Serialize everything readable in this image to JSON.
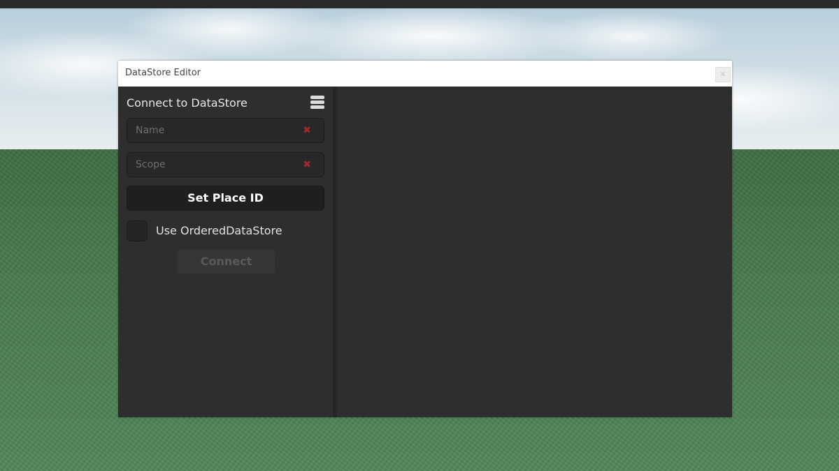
{
  "window": {
    "title": "DataStore Editor",
    "close_glyph": "✕"
  },
  "connect_panel": {
    "heading": "Connect to DataStore",
    "menu_icon": "hamburger-menu-icon",
    "name_field": {
      "placeholder": "Name",
      "value": "",
      "clear_glyph": "✖"
    },
    "scope_field": {
      "placeholder": "Scope",
      "value": "",
      "clear_glyph": "✖"
    },
    "set_place_id_label": "Set Place ID",
    "ordered_checkbox": {
      "label": "Use OrderedDataStore",
      "checked": false
    },
    "connect_label": "Connect",
    "connect_enabled": false
  },
  "colors": {
    "panel_bg": "#2e2e2e",
    "titlebar_bg": "#ffffff",
    "clear_icon": "#a22a2a",
    "button_dark": "#1f1f1f"
  }
}
